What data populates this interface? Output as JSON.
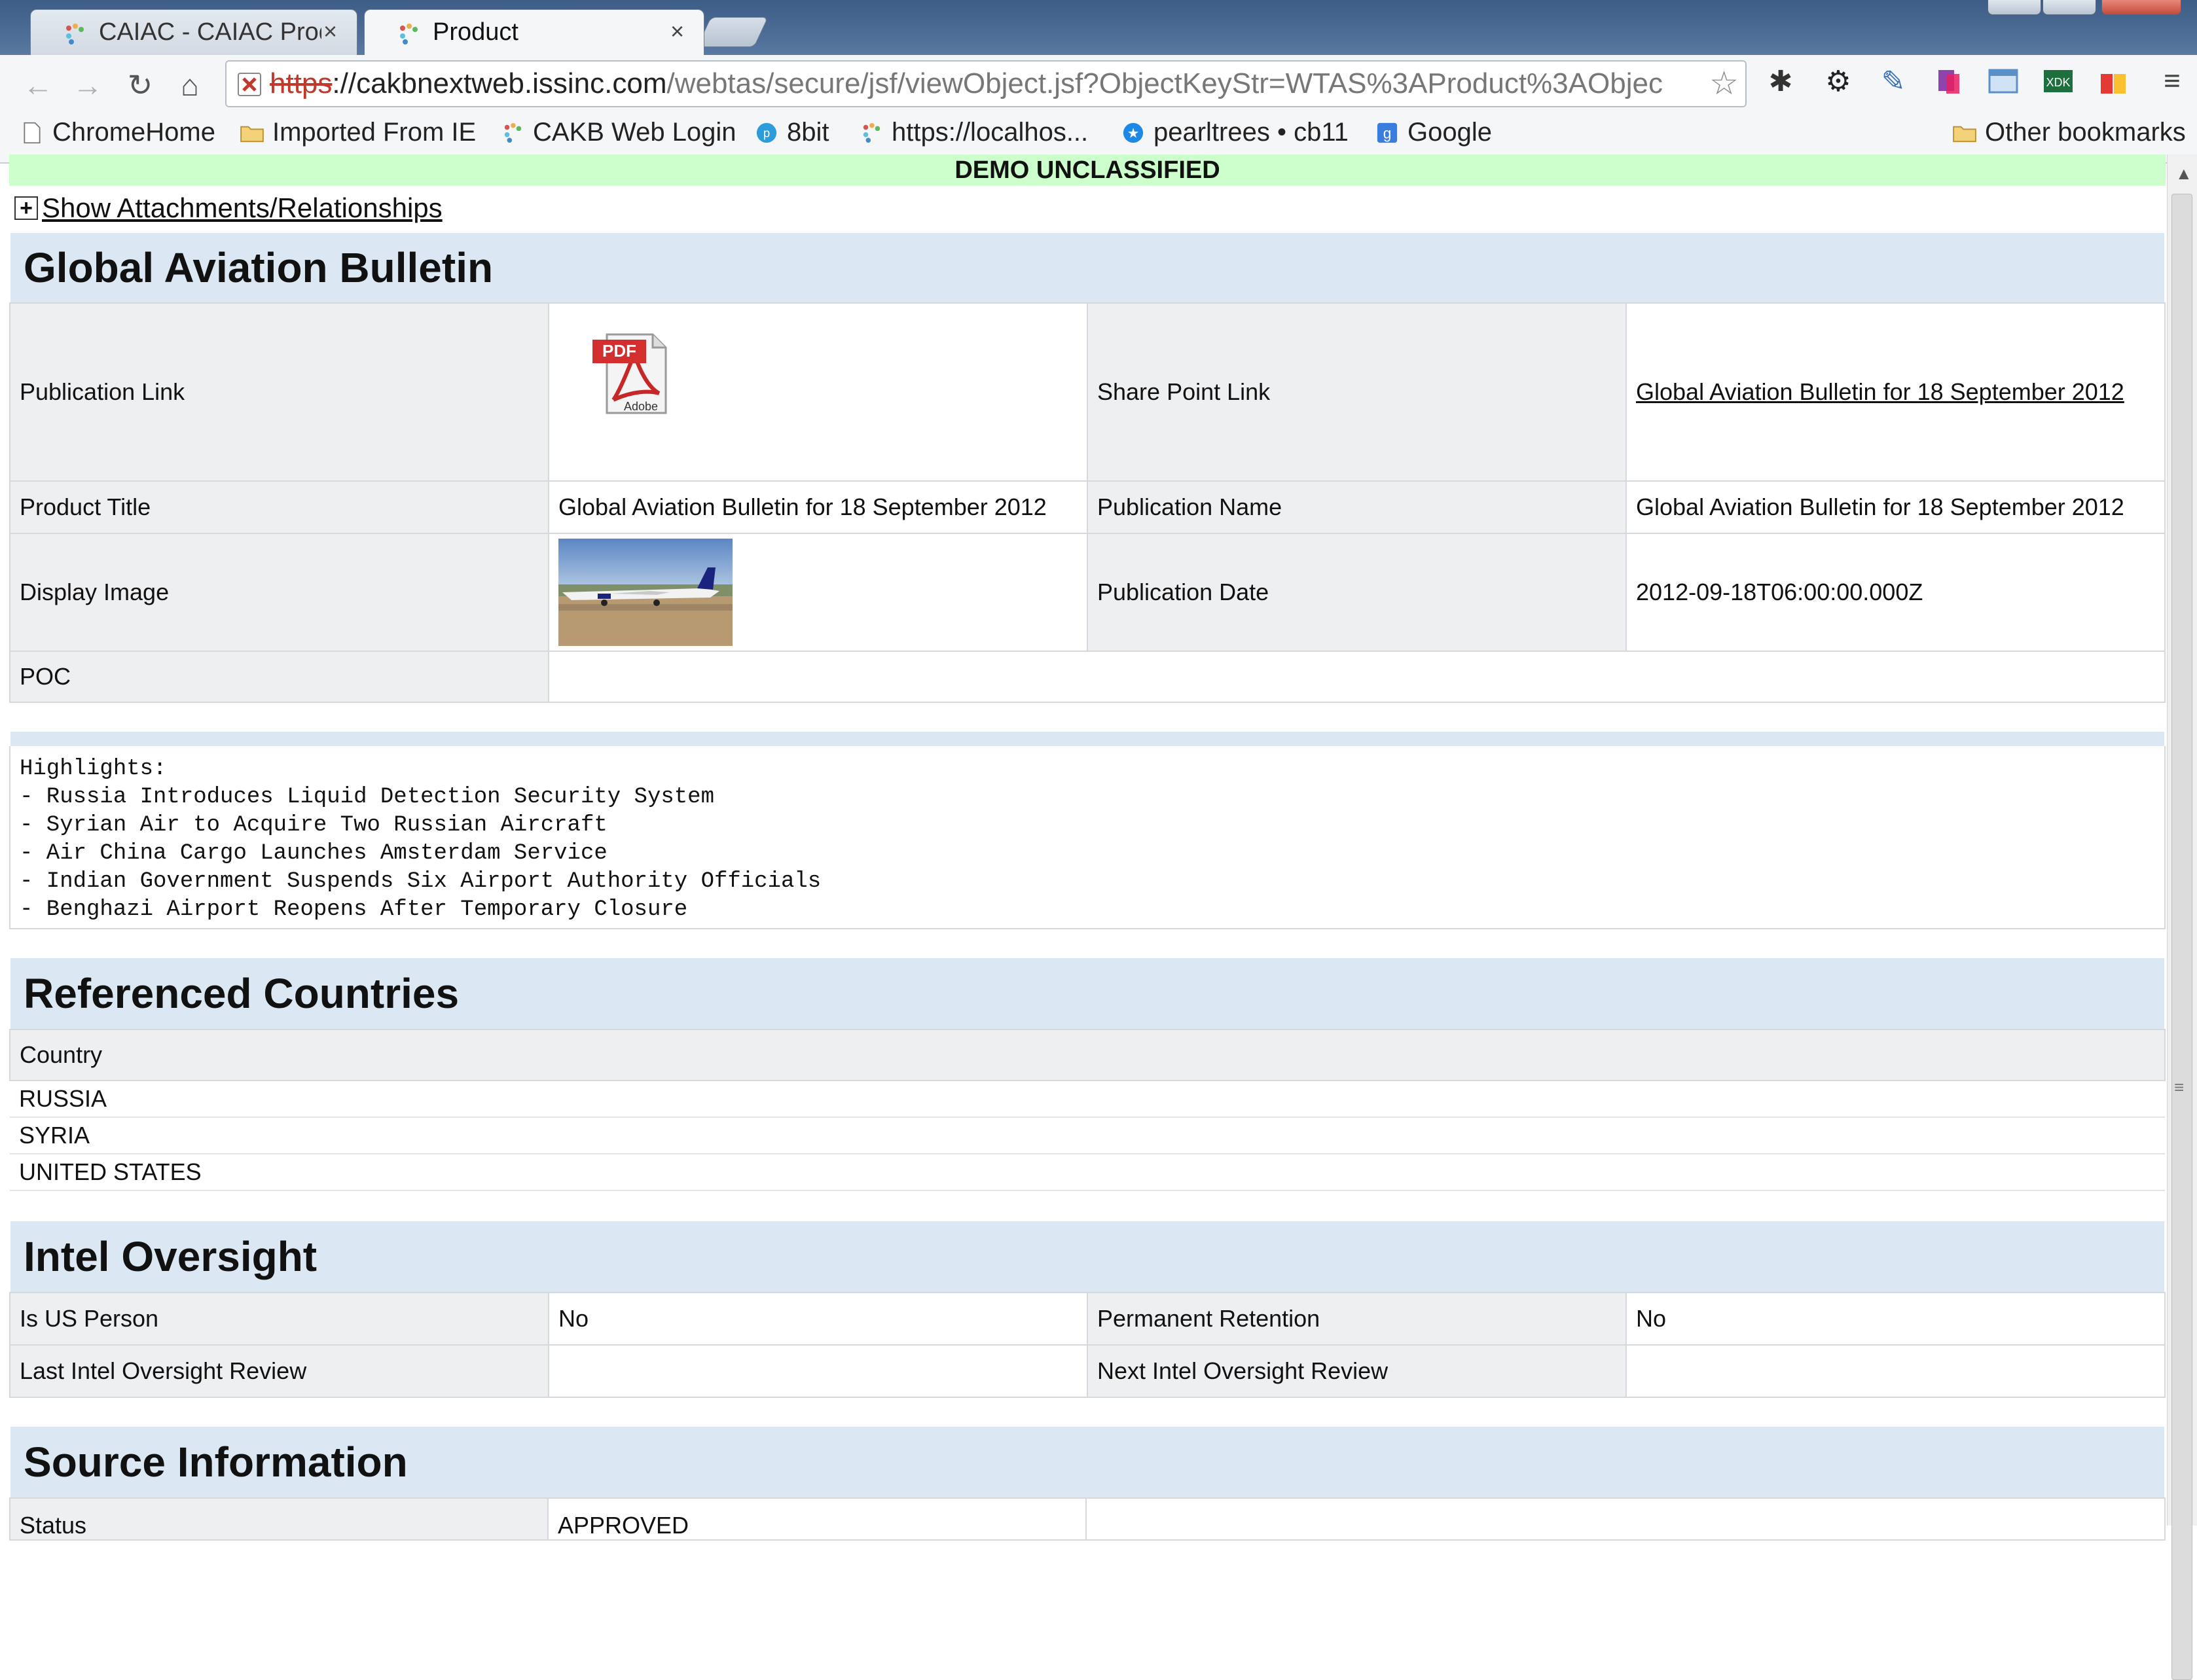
{
  "browser": {
    "tabs": [
      {
        "title": "CAIAC - CAIAC Prod",
        "active": false
      },
      {
        "title": "Product",
        "active": true
      }
    ],
    "url": {
      "scheme": "https",
      "host": "://cakbnextweb.issinc.com",
      "path": "/webtas/secure/jsf/viewObject.jsf?ObjectKeyStr=WTAS%3AProduct%3AObjec"
    },
    "bookmarks": [
      {
        "label": "ChromeHome",
        "icon": "page-icon"
      },
      {
        "label": "Imported From IE",
        "icon": "folder-icon"
      },
      {
        "label": "CAKB Web Login",
        "icon": "dots-icon"
      },
      {
        "label": "8bit",
        "icon": "circle-icon"
      },
      {
        "label": "https://localhos...",
        "icon": "dots-icon"
      },
      {
        "label": "pearltrees • cb11",
        "icon": "star-icon"
      },
      {
        "label": "Google",
        "icon": "google-icon"
      }
    ],
    "other_bookmarks": "Other bookmarks"
  },
  "page": {
    "classification": "DEMO UNCLASSIFIED",
    "attachments_link": "Show Attachments/Relationships",
    "title": "Global Aviation Bulletin",
    "details": {
      "publication_link_label": "Publication Link",
      "pdf_badge": "PDF",
      "pdf_brand": "Adobe",
      "share_point_link_label": "Share Point Link",
      "share_point_link_value": "Global Aviation Bulletin for 18 September 2012",
      "product_title_label": "Product Title",
      "product_title_value": "Global Aviation Bulletin for 18 September 2012",
      "publication_name_label": "Publication Name",
      "publication_name_value": "Global Aviation Bulletin for 18 September 2012",
      "display_image_label": "Display Image",
      "publication_date_label": "Publication Date",
      "publication_date_value": "2012-09-18T06:00:00.000Z",
      "poc_label": "POC",
      "poc_value": ""
    },
    "highlights": "Highlights:\n- Russia Introduces Liquid Detection Security System\n- Syrian Air to Acquire Two Russian Aircraft\n- Air China Cargo Launches Amsterdam Service\n- Indian Government Suspends Six Airport Authority Officials\n- Benghazi Airport Reopens After Temporary Closure",
    "countries": {
      "title": "Referenced Countries",
      "header": "Country",
      "rows": [
        "RUSSIA",
        "SYRIA",
        "UNITED STATES"
      ]
    },
    "oversight": {
      "title": "Intel Oversight",
      "is_us_person_label": "Is US Person",
      "is_us_person_value": "No",
      "permanent_retention_label": "Permanent Retention",
      "permanent_retention_value": "No",
      "last_review_label": "Last Intel Oversight Review",
      "last_review_value": "",
      "next_review_label": "Next Intel Oversight Review",
      "next_review_value": ""
    },
    "source": {
      "title": "Source Information",
      "status_label": "Status",
      "status_value": "APPROVED"
    }
  },
  "colors": {
    "classification_bg": "#ccffcc",
    "section_header_bg": "#dbe8f3",
    "label_cell_bg": "#eeeff1"
  }
}
